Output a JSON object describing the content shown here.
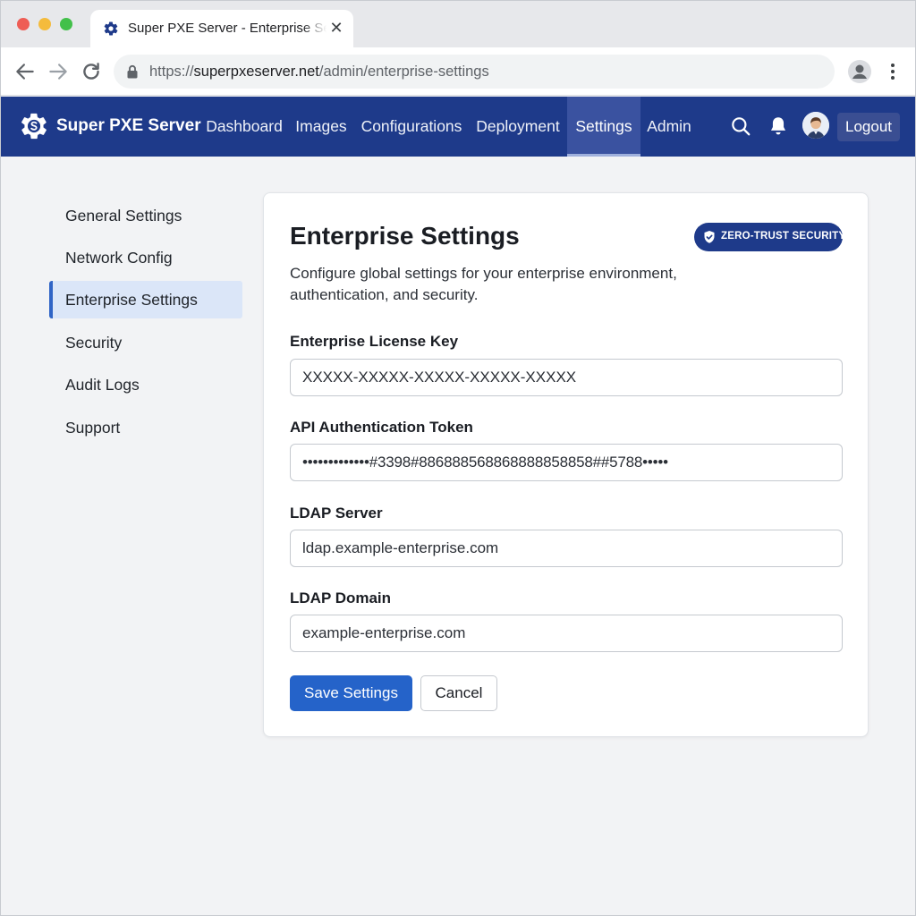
{
  "browser": {
    "tab_title": "Super PXE Server - Enterprise Settings",
    "tab_close": "✕",
    "url_prefix": "https://",
    "url_host": "superpxeserver.net",
    "url_path": "/admin/enterprise-settings"
  },
  "header": {
    "brand": "Super PXE Server",
    "nav": [
      {
        "label": "Dashboard",
        "active": false
      },
      {
        "label": "Images",
        "active": false
      },
      {
        "label": "Configurations",
        "active": false
      },
      {
        "label": "Deployment",
        "active": false
      },
      {
        "label": "Settings",
        "active": true
      },
      {
        "label": "Admin",
        "active": false
      }
    ],
    "logout_label": "Logout"
  },
  "sidebar": {
    "items": [
      {
        "label": "General Settings",
        "active": false
      },
      {
        "label": "Network Config",
        "active": false
      },
      {
        "label": "Enterprise Settings",
        "active": true
      },
      {
        "label": "Security",
        "active": false
      },
      {
        "label": "Audit Logs",
        "active": false
      },
      {
        "label": "Support",
        "active": false
      }
    ]
  },
  "main": {
    "title": "Enterprise Settings",
    "badge": "ZERO-TRUST SECURITY",
    "description": "Configure global settings for your enterprise environment, authentication, and security.",
    "fields": [
      {
        "label": "Enterprise License Key",
        "value": "XXXXX-XXXXX-XXXXX-XXXXX-XXXXX"
      },
      {
        "label": "API Authentication Token",
        "value": "•••••••••••••#3398#886888568868888858858##5788•••••"
      },
      {
        "label": "LDAP Server",
        "value": "ldap.example-enterprise.com"
      },
      {
        "label": "LDAP Domain",
        "value": "example-enterprise.com"
      }
    ],
    "save_label": "Save Settings",
    "cancel_label": "Cancel"
  },
  "colors": {
    "header_bg": "#1e3a8a",
    "accent": "#2563c9",
    "sidebar_active_bg": "#dbe6f8"
  },
  "icons": {
    "tab": "gear-icon",
    "back": "arrow-left-icon",
    "forward": "arrow-right-icon",
    "reload": "reload-icon",
    "lock": "lock-icon",
    "profile": "profile-icon",
    "menu": "kebab-menu-icon",
    "brand": "gear-logo-icon",
    "search": "search-icon",
    "notifications": "bell-icon",
    "badge": "shield-check-icon"
  }
}
